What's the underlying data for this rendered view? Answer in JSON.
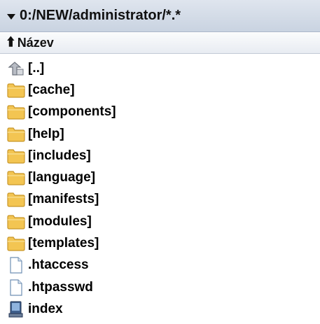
{
  "path_bar": {
    "path": "0:/NEW/administrator/*.*"
  },
  "column_header": {
    "label": "Název"
  },
  "entries": [
    {
      "name": "[..]",
      "icon": "up-folder-icon"
    },
    {
      "name": "[cache]",
      "icon": "folder-icon"
    },
    {
      "name": "[components]",
      "icon": "folder-icon"
    },
    {
      "name": "[help]",
      "icon": "folder-icon"
    },
    {
      "name": "[includes]",
      "icon": "folder-icon"
    },
    {
      "name": "[language]",
      "icon": "folder-icon"
    },
    {
      "name": "[manifests]",
      "icon": "folder-icon"
    },
    {
      "name": "[modules]",
      "icon": "folder-icon"
    },
    {
      "name": "[templates]",
      "icon": "folder-icon"
    },
    {
      "name": ".htaccess",
      "icon": "file-icon"
    },
    {
      "name": ".htpasswd",
      "icon": "file-icon"
    },
    {
      "name": "index",
      "icon": "executable-icon"
    }
  ],
  "colors": {
    "folder": "#f3c552",
    "folder_border": "#c8962a",
    "header_bar": "#c9d3e1"
  }
}
